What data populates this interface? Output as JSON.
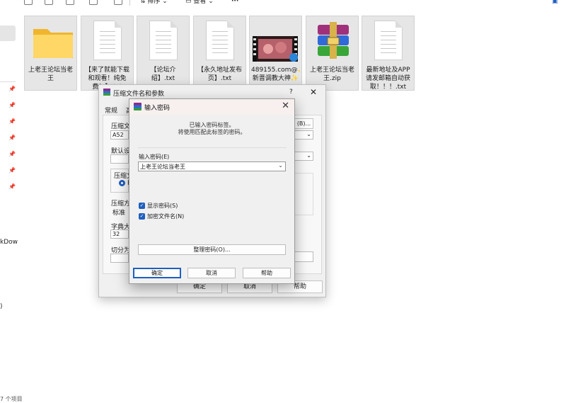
{
  "toolbar": {
    "sort_label": "排序",
    "view_label": "查看",
    "more_label": "···"
  },
  "nav": {
    "text1": "kDow",
    "text2": ")",
    "status": "7 个项目"
  },
  "files": [
    {
      "name": "上老王论坛当老王",
      "icon": "folder-icon"
    },
    {
      "name": "【来了就能下载和观看！纯免费！】.txt",
      "icon": "text-file-icon"
    },
    {
      "name": "【论坛介绍】.txt",
      "icon": "text-file-icon"
    },
    {
      "name": "【永久地址发布页】.txt",
      "icon": "text-file-icon"
    },
    {
      "name": "489155.com@✨新晋调教大神✨",
      "icon": "video-thumbnail-icon"
    },
    {
      "name": "上老王论坛当老王.zip",
      "icon": "winrar-archive-icon"
    },
    {
      "name": "最新地址及APP请发邮箱自动获取！！！.txt",
      "icon": "text-file-icon"
    }
  ],
  "bg_dialog": {
    "title": "压缩文件名和参数",
    "help_char": "?",
    "tab_general": "常规",
    "tab_second": "高",
    "label_archive": "压缩文",
    "archive_value": "A52",
    "browse": "(B)...",
    "label_default": "默认设",
    "label_format": "压缩文",
    "radio_value": "R",
    "label_method": "压缩方",
    "method_value": "标准",
    "label_dict": "字典大",
    "dict_value": "32",
    "label_split": "切分为",
    "ok": "确定",
    "cancel": "取消",
    "help": "帮助"
  },
  "pw_dialog": {
    "title": "输入密码",
    "hint1": "已输入密码标签。",
    "hint2": "将使用匹配此标签的密码。",
    "field_label": "输入密码(E)",
    "field_value": "上老王论坛当老王",
    "show_password": "显示密码(S)",
    "encrypt_names": "加密文件名(N)",
    "organize": "整理密码(O)...",
    "ok": "确定",
    "cancel": "取消",
    "help": "帮助"
  },
  "colors": {
    "accent": "#1f5fbf",
    "tile_bg": "#e6e6e6",
    "dialog_bg": "#f0f0f0"
  }
}
